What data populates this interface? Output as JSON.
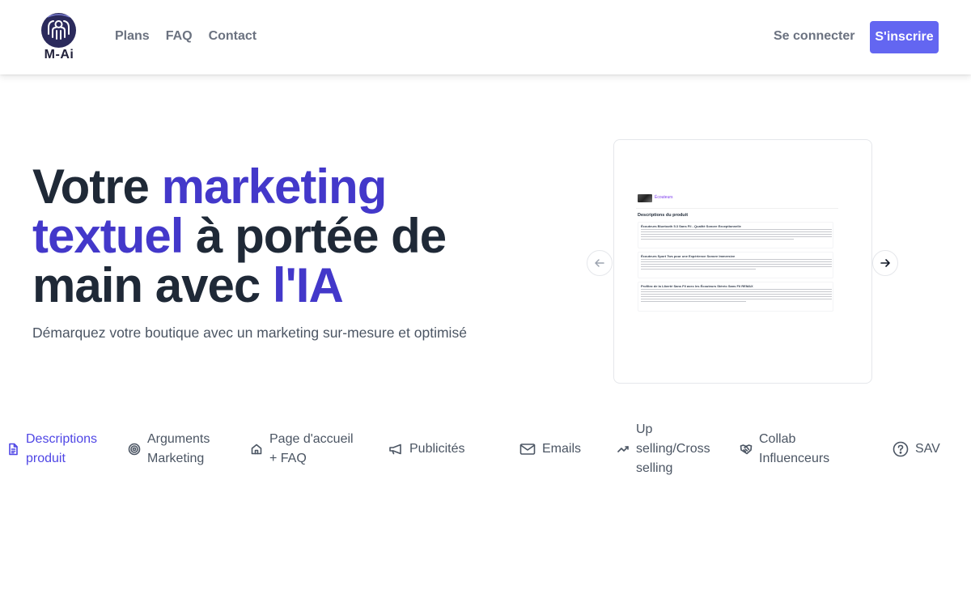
{
  "header": {
    "logo_text": "M-Ai",
    "nav": [
      {
        "label": "Plans"
      },
      {
        "label": "FAQ"
      },
      {
        "label": "Contact"
      }
    ],
    "login_label": "Se connecter",
    "signup_label": "S'inscrire"
  },
  "hero": {
    "title_parts": {
      "p1": "Votre ",
      "a1": "marketing textuel",
      "p2": " à portée de main avec ",
      "a2": "l'IA"
    },
    "subtitle": "Démarquez votre boutique avec un marketing sur-mesure et optimisé"
  },
  "carousel": {
    "prev_icon": "arrow-left-icon",
    "next_icon": "arrow-right-icon",
    "preview": {
      "category": "Écouteurs",
      "heading": "Descriptions du produit",
      "cards": [
        {
          "title": "Écouteurs Bluetooth 5.3 Sans Fil - Qualité Sonore Exceptionnelle"
        },
        {
          "title": "Écouteurs Sport Tws pour une Expérience Sonore Immersive"
        },
        {
          "title": "Profitez de la Liberté Sans Fil avec les Écouteurs Stéréo Sans Fil REMAX"
        }
      ]
    }
  },
  "features": [
    {
      "label": "Descriptions produit",
      "icon": "document-icon",
      "active": true
    },
    {
      "label": "Arguments Marketing",
      "icon": "target-icon",
      "active": false
    },
    {
      "label": "Page d'accueil + FAQ",
      "icon": "home-icon",
      "active": false
    },
    {
      "label": "Publicités",
      "icon": "megaphone-icon",
      "active": false
    },
    {
      "label": "Emails",
      "icon": "mail-icon",
      "active": false
    },
    {
      "label": "Up selling/Cross selling",
      "icon": "trending-up-icon",
      "active": false
    },
    {
      "label": "Collab Influenceurs",
      "icon": "handshake-icon",
      "active": false
    },
    {
      "label": "SAV",
      "icon": "question-circle-icon",
      "active": false
    }
  ],
  "colors": {
    "accent": "#4338ca",
    "button": "#6366f1",
    "active_tab": "#4f46e5",
    "text_dark": "#1f2937",
    "text_muted": "#6b7280"
  }
}
